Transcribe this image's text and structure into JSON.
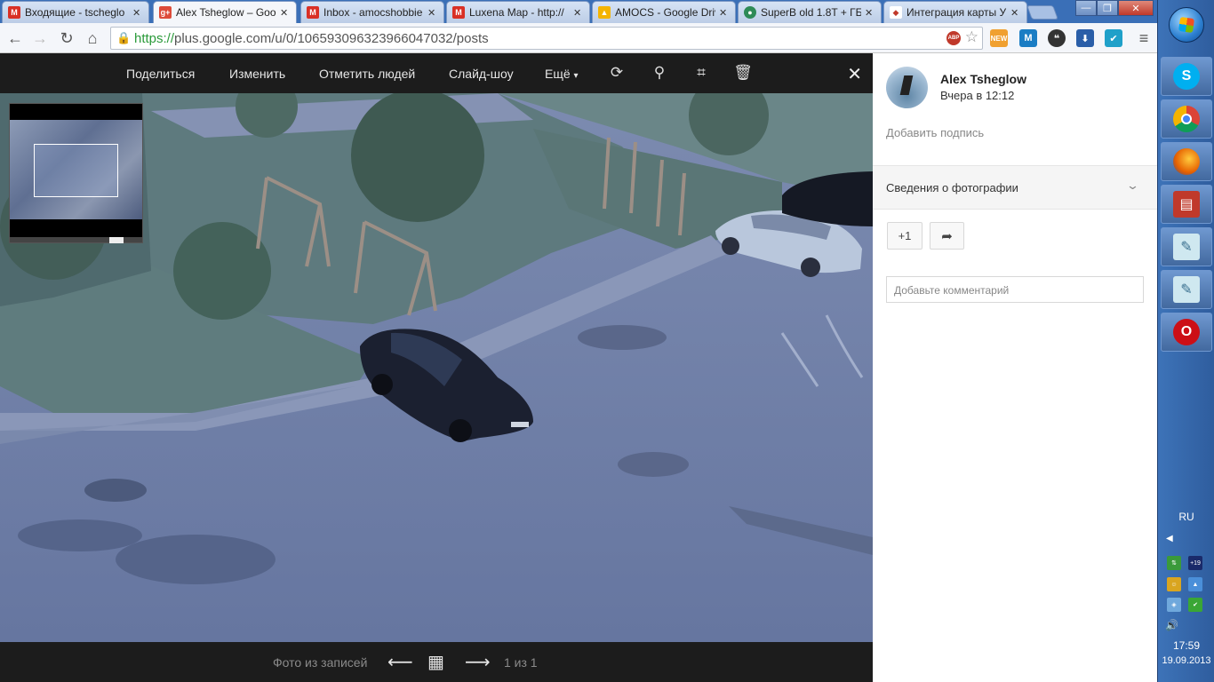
{
  "tabs": [
    {
      "title": "Входящие - tscheglo",
      "favicon": "gmail-icon",
      "favicon_color": "#d93025",
      "active": false
    },
    {
      "title": "Alex Tsheglow – Goo",
      "favicon": "google-plus-icon",
      "favicon_color": "#dd4b39",
      "active": true
    },
    {
      "title": "Inbox - amocshobbie",
      "favicon": "gmail-icon",
      "favicon_color": "#d93025",
      "active": false
    },
    {
      "title": "Luxena Map - http://",
      "favicon": "gmail-icon",
      "favicon_color": "#d93025",
      "active": false
    },
    {
      "title": "AMOCS - Google Driv",
      "favicon": "google-drive-icon",
      "favicon_color": "#f4b400",
      "active": false
    },
    {
      "title": "SuperB old 1.8T + ГБ",
      "favicon": "superb-icon",
      "favicon_color": "#2e8b57",
      "active": false
    },
    {
      "title": "Интеграция карты У",
      "favicon": "map-icon",
      "favicon_color": "#c0392b",
      "active": false
    }
  ],
  "address": {
    "scheme": "https://",
    "rest": "plus.google.com/u/0/106593096323966047032/posts"
  },
  "lightbox": {
    "actions": [
      "Поделиться",
      "Изменить",
      "Отметить людей",
      "Слайд-шоу",
      "Ещё"
    ],
    "footer": {
      "source": "Фото из записей",
      "counter": "1 из 1"
    }
  },
  "post": {
    "author": "Alex Tsheglow",
    "time": "Вчера в 12:12",
    "caption_placeholder": "Добавить подпись",
    "photo_info_label": "Сведения о фотографии",
    "plus_one_label": "+1",
    "comment_placeholder": "Добавьте комментарий"
  },
  "taskbar": {
    "language": "RU",
    "time": "17:59",
    "date": "19.09.2013"
  },
  "colors": {
    "lightbox_bg": "#1c1c1c",
    "https_green": "#2b9a3a",
    "taskbar_blue": "#3d73b8"
  }
}
